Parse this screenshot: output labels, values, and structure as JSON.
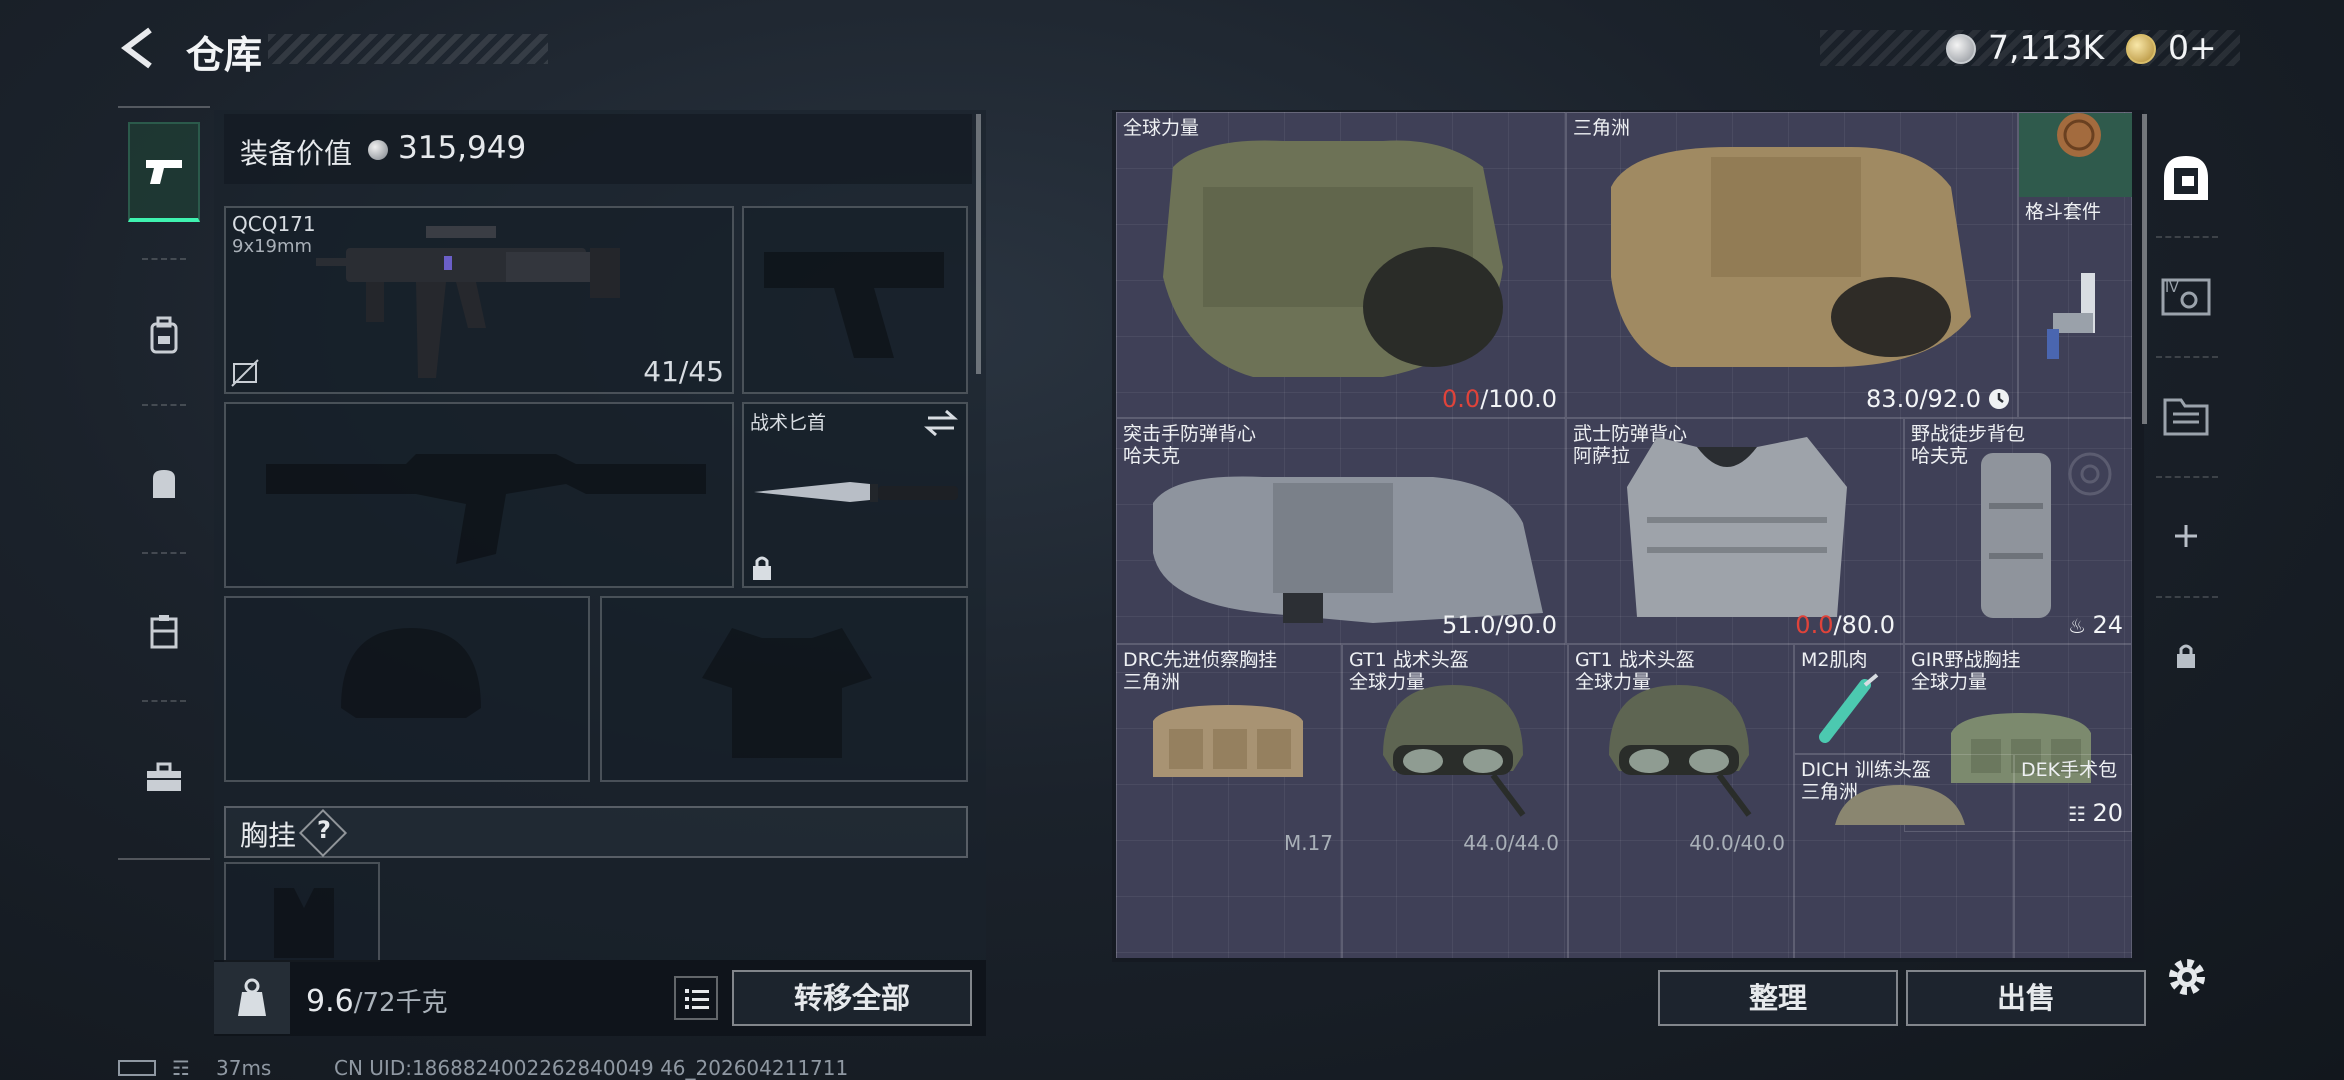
{
  "header": {
    "title": "仓库",
    "silver_value": "7,113K",
    "gold_value": "0+"
  },
  "left_panel": {
    "value_label": "装备价值",
    "value_amount": "315,949",
    "primary_weapon": {
      "name": "QCQ171",
      "caliber": "9x19mm",
      "ammo": "41/45"
    },
    "knife_label": "战术匕首",
    "chest_rig_label": "胸挂",
    "chest_rig_help": "?",
    "weight_current": "9.6",
    "weight_max": "/72千克",
    "transfer_label": "转移全部"
  },
  "warehouse": {
    "items": [
      {
        "line1": "全球力量",
        "line2": "",
        "dur_cur": "0.0",
        "dur_max": "/100.0",
        "dur_cur_red": true
      },
      {
        "line1": "三角洲",
        "line2": "",
        "dur_cur": "83.0",
        "dur_max": "/92.0",
        "dur_cur_red": false
      },
      {
        "line1": "格斗套件",
        "line2": ""
      },
      {
        "line1": "突击手防弹背心",
        "line2": "哈夫克",
        "dur_cur": "51.0",
        "dur_max": "/90.0",
        "dur_cur_red": false
      },
      {
        "line1": "武士防弹背心",
        "line2": "阿萨拉",
        "dur_cur": "0.0",
        "dur_max": "/80.0",
        "dur_cur_red": true
      },
      {
        "line1": "野战徒步背包",
        "line2": "哈夫克",
        "count": "24"
      },
      {
        "line1": "GIR野战胸挂",
        "line2": "全球力量",
        "count": "20"
      },
      {
        "line1": "DRC先进侦察胸挂",
        "line2": "三角洲",
        "dur_cur": "",
        "dur_max": "M.17"
      },
      {
        "line1": "GT1 战术头盔",
        "line2": "全球力量",
        "dur_cur": "",
        "dur_max": "44.0/44.0"
      },
      {
        "line1": "GT1 战术头盔",
        "line2": "全球力量",
        "dur_cur": "",
        "dur_max": "40.0/40.0"
      },
      {
        "line1": "M2肌肉",
        "line2": ""
      },
      {
        "line1": "DICH 训练头盔",
        "line2": "三角洲"
      },
      {
        "line1": "DEK手术包",
        "line2": ""
      }
    ],
    "sort_label": "整理",
    "sell_label": "出售"
  },
  "status": {
    "ping": "37ms",
    "uid": "CN UID:1868824002262840049 46_202604211711"
  },
  "colors": {
    "accent": "#3ff2b0",
    "durability_low": "#e0433a",
    "grid_bg": "#3f4057"
  },
  "icons": [
    "back-arrow-icon",
    "silver-coin-icon",
    "gold-coin-icon",
    "pistol-icon",
    "backpack-icon",
    "bag-icon",
    "vest-icon",
    "toolbox-icon",
    "safe-icon",
    "crate-icon",
    "folder-icon",
    "plus-icon",
    "lock-icon",
    "list-icon",
    "settings-icon"
  ]
}
